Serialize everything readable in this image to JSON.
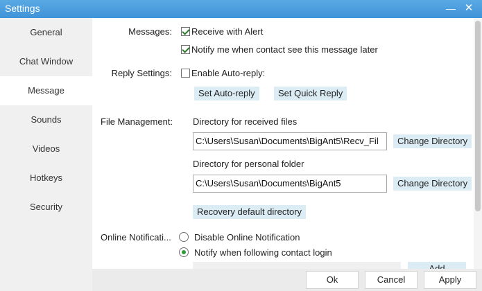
{
  "window": {
    "title": "Settings",
    "minimize": "—",
    "close": "✕"
  },
  "sidebar": {
    "items": [
      {
        "label": "General"
      },
      {
        "label": "Chat Window"
      },
      {
        "label": "Message"
      },
      {
        "label": "Sounds"
      },
      {
        "label": "Videos"
      },
      {
        "label": "Hotkeys"
      },
      {
        "label": "Security"
      }
    ],
    "active": "Message"
  },
  "messages": {
    "label": "Messages:",
    "receive_alert": {
      "label": "Receive with Alert",
      "checked": true
    },
    "notify_later": {
      "label": "Notify me when contact see this message later",
      "checked": true
    }
  },
  "reply": {
    "label": "Reply Settings:",
    "auto_reply": {
      "label": "Enable Auto-reply:",
      "checked": false
    },
    "set_auto_reply": "Set Auto-reply",
    "set_quick_reply": "Set Quick Reply"
  },
  "files": {
    "label": "File Management:",
    "received_label": "Directory for received files",
    "received_path": "C:\\Users\\Susan\\Documents\\BigAnt5\\Recv_Fil",
    "change1": "Change Directory",
    "personal_label": "Directory for personal folder",
    "personal_path": "C:\\Users\\Susan\\Documents\\BigAnt5",
    "change2": "Change Directory",
    "recovery": "Recovery default directory"
  },
  "online": {
    "label": "Online Notificati...",
    "disable": {
      "label": "Disable Online Notification",
      "selected": false
    },
    "notify": {
      "label": "Notify when following contact login",
      "selected": true
    },
    "add": "Add"
  },
  "footer": {
    "ok": "Ok",
    "cancel": "Cancel",
    "apply": "Apply"
  }
}
